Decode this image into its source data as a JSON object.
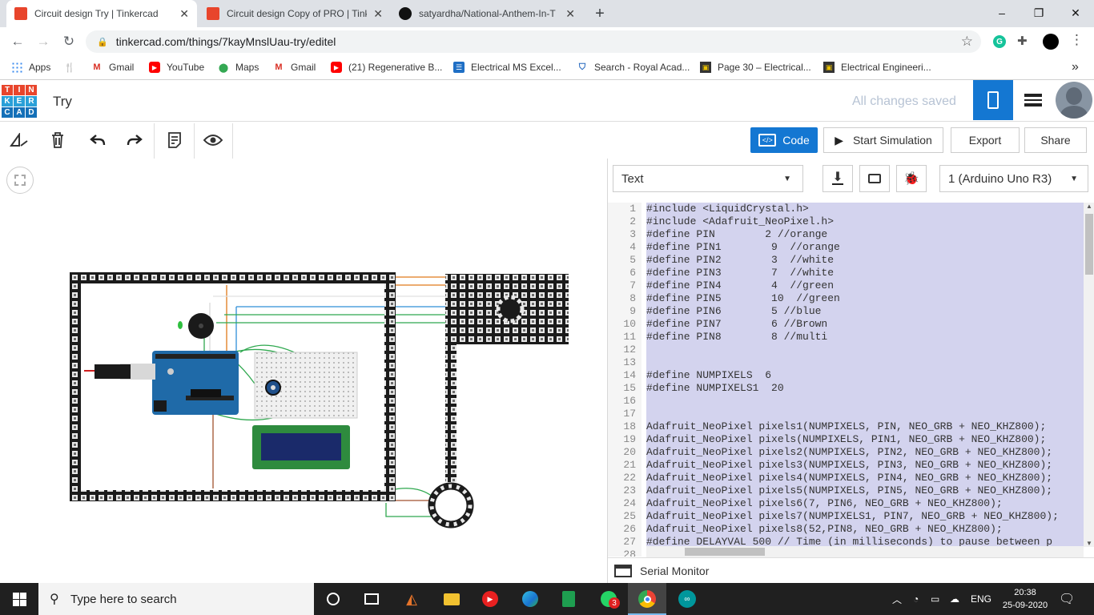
{
  "browser": {
    "tabs": [
      {
        "title": "Circuit design Try | Tinkercad",
        "active": true
      },
      {
        "title": "Circuit design Copy of PRO | Tink",
        "active": false
      },
      {
        "title": "satyardha/National-Anthem-In-T",
        "active": false
      }
    ],
    "close_glyph": "✕",
    "new_tab": "+",
    "window_controls": {
      "minimize": "–",
      "maximize": "❐",
      "close": "✕"
    },
    "url": "tinkercad.com/things/7kayMnslUau-try/editel",
    "bookmarks": [
      "Apps",
      "Gmail",
      "YouTube",
      "Maps",
      "Gmail",
      "(21) Regenerative B...",
      "Electrical MS Excel...",
      "Search - Royal Acad...",
      "Page 30 – Electrical...",
      "Electrical Engineeri..."
    ],
    "bookmarks_more": "»"
  },
  "tinkercad": {
    "logo_letters": [
      "T",
      "I",
      "N",
      "K",
      "E",
      "R",
      "C",
      "A",
      "D"
    ],
    "design_name": "Try",
    "save_status": "All changes saved"
  },
  "toolbar": {
    "code_label": "Code",
    "start_sim_label": "Start Simulation",
    "export_label": "Export",
    "share_label": "Share"
  },
  "code_panel": {
    "mode": "Text",
    "device": "1 (Arduino Uno R3)",
    "serial_monitor": "Serial Monitor",
    "line_numbers": [
      "1",
      "2",
      "3",
      "4",
      "5",
      "6",
      "7",
      "8",
      "9",
      "10",
      "11",
      "12",
      "13",
      "14",
      "15",
      "16",
      "17",
      "18",
      "19",
      "20",
      "21",
      "22",
      "23",
      "24",
      "25",
      "26",
      "27",
      "28"
    ],
    "lines": [
      "#include <LiquidCrystal.h>",
      "#include <Adafruit_NeoPixel.h>",
      "#define PIN        2 //orange",
      "#define PIN1        9  //orange",
      "#define PIN2        3  //white",
      "#define PIN3        7  //white",
      "#define PIN4        4  //green",
      "#define PIN5        10  //green",
      "#define PIN6        5 //blue",
      "#define PIN7        6 //Brown",
      "#define PIN8        8 //multi",
      "",
      "",
      "#define NUMPIXELS  6",
      "#define NUMPIXELS1  20",
      "",
      "",
      "Adafruit_NeoPixel pixels1(NUMPIXELS, PIN, NEO_GRB + NEO_KHZ800);",
      "Adafruit_NeoPixel pixels(NUMPIXELS, PIN1, NEO_GRB + NEO_KHZ800);",
      "Adafruit_NeoPixel pixels2(NUMPIXELS, PIN2, NEO_GRB + NEO_KHZ800);",
      "Adafruit_NeoPixel pixels3(NUMPIXELS, PIN3, NEO_GRB + NEO_KHZ800);",
      "Adafruit_NeoPixel pixels4(NUMPIXELS, PIN4, NEO_GRB + NEO_KHZ800);",
      "Adafruit_NeoPixel pixels5(NUMPIXELS, PIN5, NEO_GRB + NEO_KHZ800);",
      "Adafruit_NeoPixel pixels6(7, PIN6, NEO_GRB + NEO_KHZ800);",
      "Adafruit_NeoPixel pixels7(NUMPIXELS1, PIN7, NEO_GRB + NEO_KHZ800);",
      "Adafruit_NeoPixel pixels8(52,PIN8, NEO_GRB + NEO_KHZ800);",
      "#define DELAYVAL 500 // Time (in milliseconds) to pause between p",
      ""
    ]
  },
  "taskbar": {
    "search_placeholder": "Type here to search",
    "whatsapp_badge": "3",
    "language": "ENG",
    "time": "20:38",
    "date": "25-09-2020"
  },
  "colors": {
    "accent": "#1477d2",
    "code_selection": "#d3d3ee",
    "logo": [
      "#e8452c",
      "#e8452c",
      "#e8452c",
      "#2aa0d8",
      "#2aa0d8",
      "#2aa0d8",
      "#1470b8",
      "#1470b8",
      "#1470b8"
    ]
  }
}
